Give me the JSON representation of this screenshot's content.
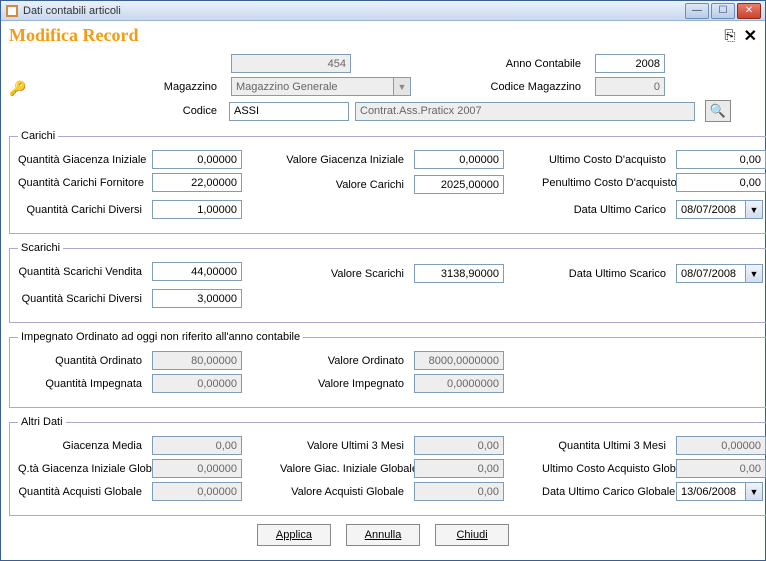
{
  "window": {
    "title": "Dati contabili articoli"
  },
  "header": {
    "title": "Modifica Record"
  },
  "head_fields": {
    "id_label": "",
    "id_value": "454",
    "anno_label": "Anno Contabile",
    "anno_value": "2008",
    "magazzino_label": "Magazzino",
    "magazzino_value": "Magazzino Generale",
    "codmag_label": "Codice Magazzino",
    "codmag_value": "0",
    "codice_label": "Codice",
    "codice_value": "ASSI",
    "codice_desc": "Contrat.Ass.Praticx 2007"
  },
  "carichi": {
    "legend": "Carichi",
    "qta_giac_iniz_label": "Quantità Giacenza Iniziale",
    "qta_giac_iniz": "0,00000",
    "val_giac_iniz_label": "Valore Giacenza Iniziale",
    "val_giac_iniz": "0,00000",
    "ultimo_costo_label": "Ultimo Costo D'acquisto",
    "ultimo_costo": "0,00",
    "qta_car_forn_label": "Quantità Carichi Fornitore",
    "qta_car_forn": "22,00000",
    "val_car_label": "Valore Carichi",
    "val_car": "2025,00000",
    "penult_costo_label": "Penultimo Costo D'acquisto",
    "penult_costo": "0,00",
    "qta_car_div_label": "Quantità Carichi Diversi",
    "qta_car_div": "1,00000",
    "data_ult_car_label": "Data Ultimo Carico",
    "data_ult_car": "08/07/2008"
  },
  "scarichi": {
    "legend": "Scarichi",
    "qta_sc_vend_label": "Quantità Scarichi Vendita",
    "qta_sc_vend": "44,00000",
    "val_sc_label": "Valore Scarichi",
    "val_sc": "3138,90000",
    "data_ult_sc_label": "Data Ultimo Scarico",
    "data_ult_sc": "08/07/2008",
    "qta_sc_div_label": "Quantità Scarichi Diversi",
    "qta_sc_div": "3,00000"
  },
  "impegnato": {
    "legend": "Impegnato Ordinato ad oggi non riferito all'anno contabile",
    "qta_ord_label": "Quantità Ordinato",
    "qta_ord": "80,00000",
    "val_ord_label": "Valore Ordinato",
    "val_ord": "8000,0000000",
    "qta_imp_label": "Quantità Impegnata",
    "qta_imp": "0,00000",
    "val_imp_label": "Valore Impegnato",
    "val_imp": "0,0000000"
  },
  "altri": {
    "legend": "Altri Dati",
    "giac_media_label": "Giacenza Media",
    "giac_media": "0,00",
    "val_u3m_label": "Valore Ultimi 3 Mesi",
    "val_u3m": "0,00",
    "qta_u3m_label": "Quantita Ultimi 3 Mesi",
    "qta_u3m": "0,00000",
    "qta_giac_glob_label": "Q.tà Giacenza Iniziale Globale",
    "qta_giac_glob": "0,00000",
    "val_giac_glob_label": "Valore Giac. Iniziale Globale",
    "val_giac_glob": "0,00",
    "ult_costo_glob_label": "Ultimo Costo Acquisto Globale",
    "ult_costo_glob": "0,00",
    "qta_acq_glob_label": "Quantità Acquisti Globale",
    "qta_acq_glob": "0,00000",
    "val_acq_glob_label": "Valore Acquisti Globale",
    "val_acq_glob": "0,00",
    "data_ult_car_glob_label": "Data Ultimo Carico Globale",
    "data_ult_car_glob": "13/06/2008"
  },
  "buttons": {
    "applica": "Applica",
    "annulla": "Annulla",
    "chiudi": "Chiudi"
  }
}
